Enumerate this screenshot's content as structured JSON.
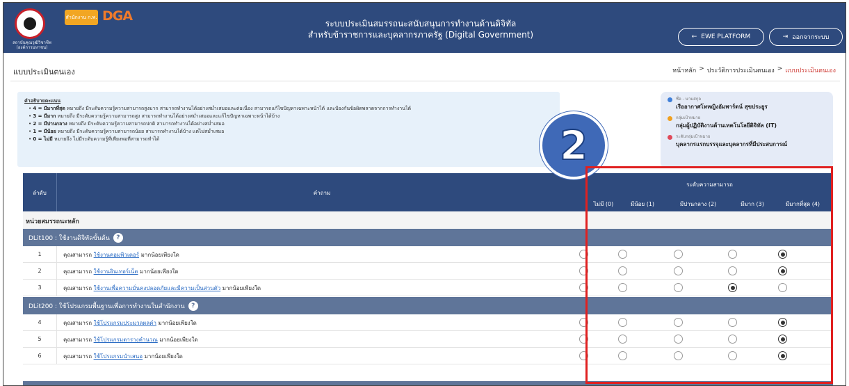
{
  "header": {
    "org_caption": "สถาบันคุณวุฒิวิชาชีพ (องค์การมหาชน)",
    "ocsc_label": "สำนักงาน ก.พ.",
    "dga_label": "DGA",
    "title_line1": "ระบบประเมินสมรรถนะสนับสนุนการทำงานด้านดิจิทัล",
    "title_line2": "สำหรับข้าราชการและบุคลากรภาครัฐ (Digital Government)",
    "ewe_button": "EWE PLATFORM",
    "logout_button": "ออกจากระบบ",
    "ewe_icon": "arrow-left-icon",
    "logout_icon": "logout-icon"
  },
  "page": {
    "title": "แบบประเมินตนเอง",
    "breadcrumb": [
      "หน้าหลัก",
      ">",
      "ประวัติการประเมินตนเอง",
      ">",
      "แบบประเมินตนเอง"
    ]
  },
  "legend": {
    "heading": "คำอธิบายคะแนน",
    "items": [
      {
        "key": "4 = มีมากที่สุด",
        "desc": "หมายถึง มีระดับความรู้ความสามารถสูงมาก สามารถทำงานได้อย่างสม่ำเสมอและต่อเนื่อง สามารถแก้ไขปัญหาเฉพาะหน้าได้ และป้องกันข้อผิดพลาดจากการทำงานได้"
      },
      {
        "key": "3 = มีมาก",
        "desc": "หมายถึง มีระดับความรู้ความสามารถสูง สามารถทำงานได้อย่างสม่ำเสมอและแก้ไขปัญหาเฉพาะหน้าได้บ้าง"
      },
      {
        "key": "2 = มีปานกลาง",
        "desc": "หมายถึง มีระดับความรู้ความสามารถปกติ สามารถทำงานได้อย่างสม่ำเสมอ"
      },
      {
        "key": "1 = มีน้อย",
        "desc": "หมายถึง มีระดับความรู้ความสามารถน้อย สามารถทำงานได้บ้าง แต่ไม่สม่ำเสมอ"
      },
      {
        "key": "0 = ไม่มี",
        "desc": "หมายถึง ไม่มีระดับความรู้ที่เพียงพอที่สามารถทำได้"
      }
    ]
  },
  "profile": {
    "name_label": "ชื่อ - นามสกุล",
    "name": "เรืออากาศโทหญิงอัมพาร์ตน์ สุขประยูร",
    "group_label": "กลุ่มเป้าหมาย",
    "group": "กลุ่มผู้ปฏิบัติงานด้านเทคโนโลยีดิจิทัล (IT)",
    "level_label": "ระดับกลุ่มเป้าหมาย",
    "level": "บุคลากรแรกบรรจุและบุคลากรที่มีประสบการณ์",
    "dot_colors": [
      "#3f7fd8",
      "#f0a020",
      "#e04a5a"
    ]
  },
  "step_badge": "2",
  "table": {
    "col_order": "ลำดับ",
    "col_question": "คำถาม",
    "col_level": "ระดับความสามารถ",
    "options": [
      "ไม่มี (0)",
      "มีน้อย (1)",
      "มีปานกลาง (2)",
      "มีมาก (3)",
      "มีมากที่สุด (4)"
    ],
    "section": "หน่วยสมรรถนะหลัก",
    "groups": [
      {
        "title": "DLit100 : ใช้งานดิจิทัลขั้นต้น",
        "questions": [
          {
            "num": "1",
            "pre": "คุณสามารถ",
            "link": "ใช้งานคอมพิวเตอร์",
            "post": "มากน้อยเพียงใด",
            "selected": 4
          },
          {
            "num": "2",
            "pre": "คุณสามารถ",
            "link": "ใช้งานอินเทอร์เน็ต",
            "post": "มากน้อยเพียงใด",
            "selected": 4
          },
          {
            "num": "3",
            "pre": "คุณสามารถ",
            "link": "ใช้งานเพื่อความมั่นคงปลอดภัยและมีความเป็นส่วนตัว",
            "post": "มากน้อยเพียงใด",
            "selected": 3
          }
        ]
      },
      {
        "title": "DLit200 : ใช้โปรแกรมพื้นฐานเพื่อการทำงานในสำนักงาน",
        "questions": [
          {
            "num": "4",
            "pre": "คุณสามารถ",
            "link": "ใช้โปรแกรมประมวลผลคำ",
            "post": "มากน้อยเพียงใด",
            "selected": 4
          },
          {
            "num": "5",
            "pre": "คุณสามารถ",
            "link": "ใช้โปรแกรมตารางคำนวณ",
            "post": "มากน้อยเพียงใด",
            "selected": 4
          },
          {
            "num": "6",
            "pre": "คุณสามารถ",
            "link": "ใช้โปรแกรมนำเสนอ",
            "post": "มากน้อยเพียงใด",
            "selected": 4
          }
        ]
      }
    ]
  }
}
